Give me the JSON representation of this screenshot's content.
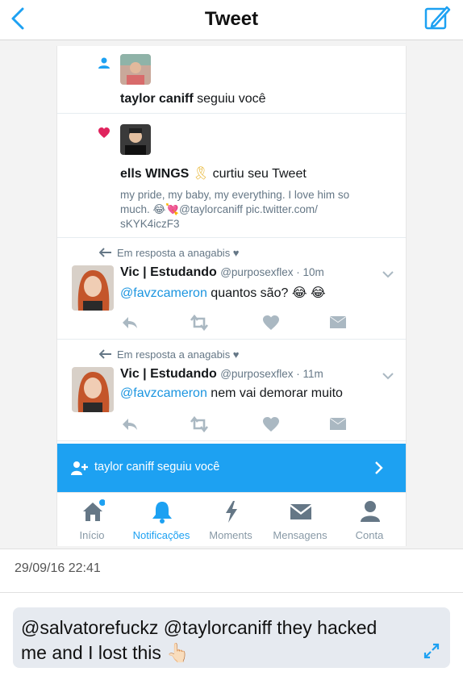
{
  "nav": {
    "title": "Tweet"
  },
  "notifications": [
    {
      "user": "taylor caniff",
      "action": "seguiu você"
    },
    {
      "user": "ells WINGS",
      "user_emoji": "🎗",
      "action": "curtiu seu Tweet",
      "quoted_line1": "my pride, my baby, my everything. I love him so",
      "quoted_line2": "much. 😂💘@taylorcaniff pic.twitter.com/",
      "quoted_line3": "sKYK4iczF3"
    }
  ],
  "tweets": [
    {
      "reply_context": "Em resposta a anagabis ♥",
      "name": "Vic | Estudando",
      "handle": "@purposexflex · 10m",
      "mention": "@favzcameron",
      "text": " quantos são? 😂 😂"
    },
    {
      "reply_context": "Em resposta a anagabis ♥",
      "name": "Vic | Estudando",
      "handle": "@purposexflex · 11m",
      "mention": "@favzcameron",
      "text": " nem vai demorar muito"
    }
  ],
  "banner": {
    "text": "taylor caniff seguiu você"
  },
  "tabs": [
    {
      "label": "Início",
      "icon": "home-icon"
    },
    {
      "label": "Notificações",
      "icon": "bell-icon"
    },
    {
      "label": "Moments",
      "icon": "lightning-icon"
    },
    {
      "label": "Mensagens",
      "icon": "envelope-icon"
    },
    {
      "label": "Conta",
      "icon": "person-icon"
    }
  ],
  "timestamp": "29/09/16 22:41",
  "caption": "@salvatorefuckz @taylorcaniff they hacked me and I lost this 👆🏻",
  "colors": {
    "accent": "#1da1f2",
    "like": "#e0245e",
    "mention": "#1b95e0"
  }
}
